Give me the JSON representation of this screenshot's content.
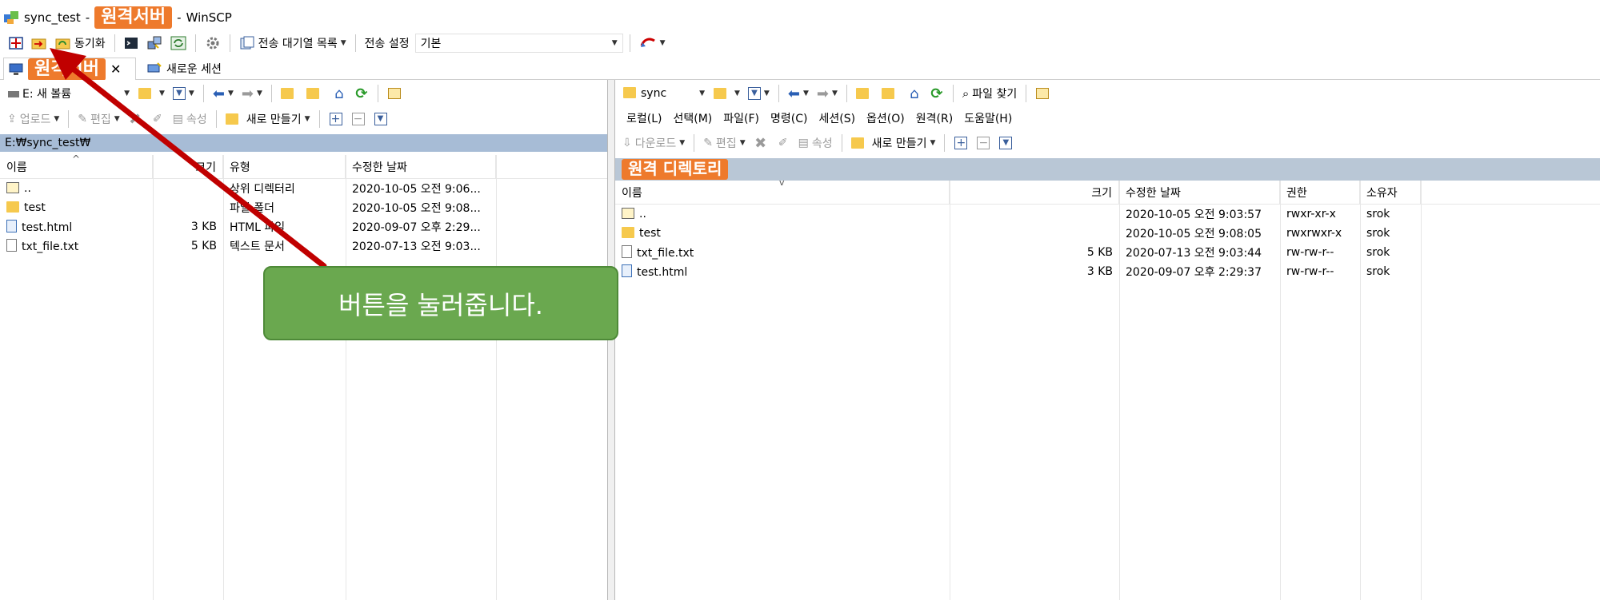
{
  "title": {
    "session": "sync_test",
    "sep1": "-",
    "redacted": "원격서버",
    "sep2": "-",
    "app": "WinSCP"
  },
  "toolbar": {
    "sync_label": "동기화",
    "queue_label": "전송 대기열 목록",
    "transfer_settings_label": "전송 설정",
    "transfer_settings_value": "기본"
  },
  "tabs": {
    "active_label": "원격서버",
    "new_session_label": "새로운 세션"
  },
  "left": {
    "drive": "E: 새 볼륨",
    "upload": "업로드",
    "edit": "편집",
    "properties": "속성",
    "new": "새로 만들기",
    "path": "E:₩sync_test₩",
    "columns": [
      "이름",
      "크기",
      "유형",
      "수정한 날짜"
    ],
    "rows": [
      {
        "name": "..",
        "size": "",
        "type": "상위 디렉터리",
        "modified": "2020-10-05  오전 9:06..."
      },
      {
        "name": "test",
        "size": "",
        "type": "파일 폴더",
        "modified": "2020-10-05  오전 9:08..."
      },
      {
        "name": "test.html",
        "size": "3 KB",
        "type": "HTML 파일",
        "modified": "2020-09-07  오후 2:29..."
      },
      {
        "name": "txt_file.txt",
        "size": "5 KB",
        "type": "텍스트 문서",
        "modified": "2020-07-13  오전 9:03..."
      }
    ]
  },
  "right": {
    "path_combo": "sync",
    "find_files": "파일 찾기",
    "menu": [
      "로컬(L)",
      "선택(M)",
      "파일(F)",
      "명령(C)",
      "세션(S)",
      "옵션(O)",
      "원격(R)",
      "도움말(H)"
    ],
    "download": "다운로드",
    "edit": "편집",
    "properties": "속성",
    "new": "새로 만들기",
    "path_label": "원격 디렉토리",
    "columns": [
      "이름",
      "크기",
      "수정한 날짜",
      "권한",
      "소유자"
    ],
    "rows": [
      {
        "name": "..",
        "size": "",
        "modified": "2020-10-05 오전 9:03:57",
        "rights": "rwxr-xr-x",
        "owner": "srok"
      },
      {
        "name": "test",
        "size": "",
        "modified": "2020-10-05 오전 9:08:05",
        "rights": "rwxrwxr-x",
        "owner": "srok"
      },
      {
        "name": "txt_file.txt",
        "size": "5 KB",
        "modified": "2020-07-13 오전 9:03:44",
        "rights": "rw-rw-r--",
        "owner": "srok"
      },
      {
        "name": "test.html",
        "size": "3 KB",
        "modified": "2020-09-07 오후 2:29:37",
        "rights": "rw-rw-r--",
        "owner": "srok"
      }
    ]
  },
  "callout": {
    "text": "버튼을 눌러줍니다."
  },
  "colors": {
    "accent_orange": "#ee7a2c",
    "callout_green": "#6aa84f",
    "arrow_red": "#c00000",
    "path_blue": "#a7bcd6"
  }
}
